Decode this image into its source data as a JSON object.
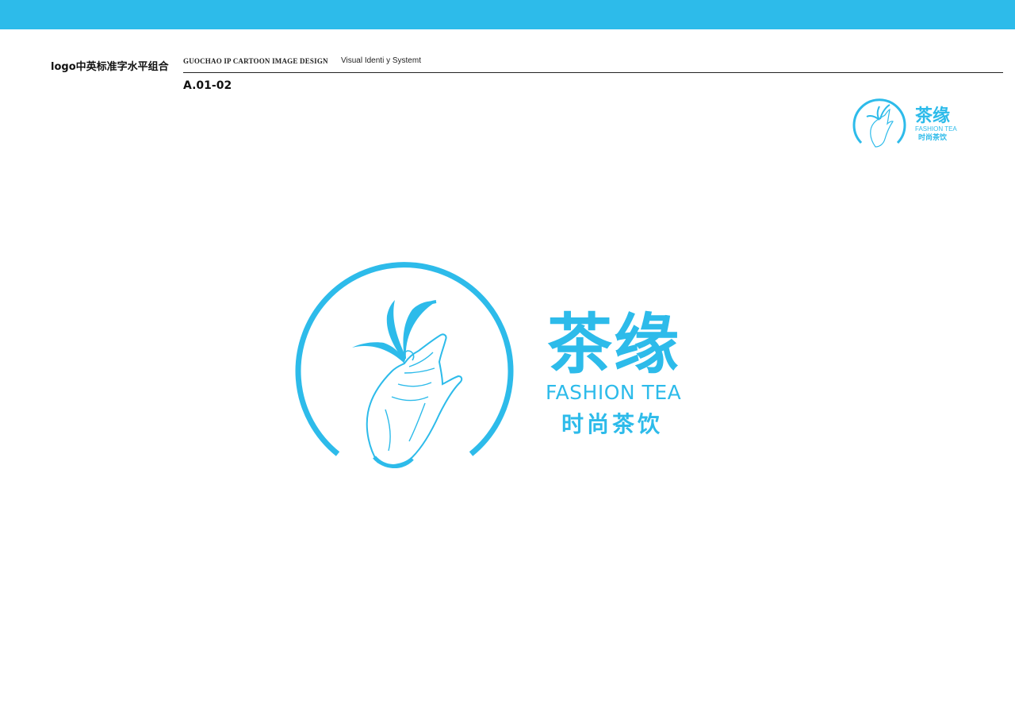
{
  "header": {
    "left_title": "logo中英标准字水平组合",
    "design_title": "GUOCHAO IP CARTOON IMAGE DESIGN",
    "system_title": "Visual Identi y Systemt",
    "page_code": "A.01-02"
  },
  "logo": {
    "brand_chinese": "茶缘",
    "brand_english": "FASHION TEA",
    "tagline_chinese": "时尚茶饮",
    "icon": "hand-holding-tea-leaf-icon"
  },
  "colors": {
    "brand_blue": "#2dbbea",
    "header_bar": "#2dbbea",
    "text_dark": "#111111"
  }
}
